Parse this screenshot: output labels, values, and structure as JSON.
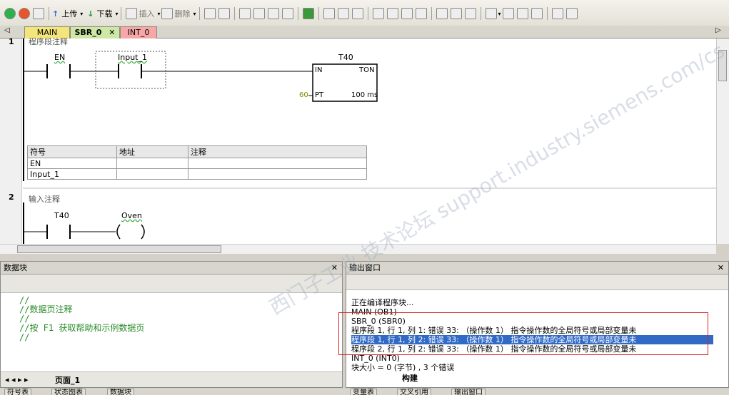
{
  "toolbar": {
    "upload_label": "上传",
    "download_label": "下载",
    "insert_label": "插入",
    "delete_label": "删除"
  },
  "tabs": [
    {
      "label": "MAIN",
      "color": "#f3e57a"
    },
    {
      "label": "SBR_0",
      "color": "#cde8a4"
    },
    {
      "label": "INT_0",
      "color": "#f7a7a7"
    }
  ],
  "segment1": {
    "number": "1",
    "comment": "程序段注释",
    "contact1": "EN",
    "contact2": "Input_1",
    "timer_name": "T40",
    "timer_in": "IN",
    "timer_type": "TON",
    "timer_pt_value": "60",
    "timer_pt": "PT",
    "timer_res": "100 ms",
    "symbol_table": {
      "headers": [
        "符号",
        "地址",
        "注释"
      ],
      "rows": [
        [
          "EN",
          "",
          ""
        ],
        [
          "Input_1",
          "",
          ""
        ]
      ]
    }
  },
  "segment2": {
    "number": "2",
    "comment": "输入注释",
    "contact": "T40",
    "coil": "Oven"
  },
  "data_block": {
    "title": "数据块",
    "lines": [
      "//",
      "//数据页注释",
      "//",
      "//按 F1 获取帮助和示例数据页",
      "//"
    ],
    "page_tab": "页面_1"
  },
  "output": {
    "title": "输出窗口",
    "lines": [
      "正在编译程序块...",
      "MAIN (OB1)",
      "SBR_0 (SBR0)",
      "程序段 1, 行 1, 列 1: 错误 33:  （操作数 1） 指令操作数的全局符号或局部变量未",
      "程序段 1, 行 1, 列 2: 错误 33:  （操作数 1） 指令操作数的全局符号或局部变量未",
      "程序段 2, 行 1, 列 2: 错误 33:  （操作数 1） 指令操作数的全局符号或局部变量未",
      "INT_0 (INT0)",
      "块大小 = 0 (字节) , 3 个错误"
    ],
    "build_tab": "构建"
  },
  "bottom_tabs_left": [
    "符号表",
    "状态图表",
    "数据块"
  ],
  "bottom_tabs_right": [
    "变量表",
    "交叉引用",
    "输出窗口"
  ],
  "watermark": "西门子工业 技术论坛 support.industry.siemens.com/cs"
}
